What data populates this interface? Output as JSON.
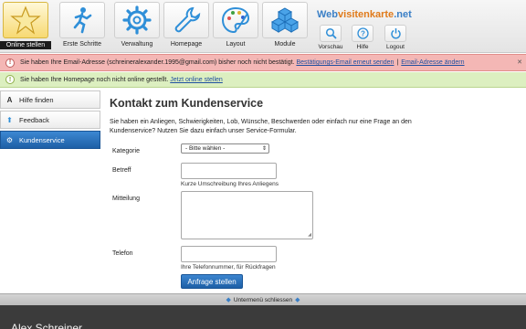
{
  "toolbar": {
    "items": [
      {
        "label": "Online stellen",
        "icon": "star-icon"
      },
      {
        "label": "Erste Schritte",
        "icon": "runner-icon"
      },
      {
        "label": "Verwaltung",
        "icon": "gear-icon"
      },
      {
        "label": "Homepage",
        "icon": "wrench-icon"
      },
      {
        "label": "Layout",
        "icon": "palette-icon"
      },
      {
        "label": "Module",
        "icon": "cubes-icon"
      }
    ],
    "brand_main": "Web",
    "brand_accent": "visitenkarte",
    "brand_tld": ".net",
    "small_items": [
      {
        "label": "Vorschau",
        "icon": "magnifier-icon"
      },
      {
        "label": "Hilfe",
        "icon": "question-icon"
      },
      {
        "label": "Logout",
        "icon": "power-icon"
      }
    ]
  },
  "notifications": {
    "error": {
      "text": "Sie haben Ihre Email-Adresse (schreineralexander.1995@gmail.com) bisher noch nicht bestätigt.",
      "link1": "Bestätigungs-Email erneut senden",
      "separator": "|",
      "link2": "Email-Adresse ändern",
      "color": "#f4b7b5"
    },
    "warning": {
      "text": "Sie haben Ihre Homepage noch nicht online gestellt.",
      "link": "Jetzt online stellen",
      "color": "#dcefc0"
    }
  },
  "sidebar": {
    "items": [
      {
        "label": "Hilfe finden",
        "icon": "font-icon",
        "active": false
      },
      {
        "label": "Feedback",
        "icon": "arrow-up-icon",
        "active": false
      },
      {
        "label": "Kundenservice",
        "icon": "gear-icon",
        "active": true
      }
    ]
  },
  "main": {
    "title": "Kontakt zum Kundenservice",
    "intro": "Sie haben ein Anliegen, Schwierigkeiten, Lob, Wünsche, Beschwerden oder einfach nur eine Frage an den Kundenservice? Nutzen Sie dazu einfach unser Service-Formular.",
    "form": {
      "category_label": "Kategorie",
      "category_value": "- Bitte wählen -",
      "subject_label": "Betreff",
      "subject_hint": "Kurze Umschreibung Ihres Anliegens",
      "message_label": "Mitteilung",
      "phone_label": "Telefon",
      "phone_hint": "Ihre Telefonnummer, für Rückfragen",
      "submit_label": "Anfrage stellen"
    }
  },
  "submenu": {
    "label": "Untermenü schliessen"
  },
  "footer": {
    "name": "Alex Schreiner"
  },
  "colors": {
    "accent": "#1d5fa6",
    "brand_blue": "#3a7fc6",
    "brand_orange": "#e07a1a",
    "footer_bg": "#3b3b3b"
  }
}
